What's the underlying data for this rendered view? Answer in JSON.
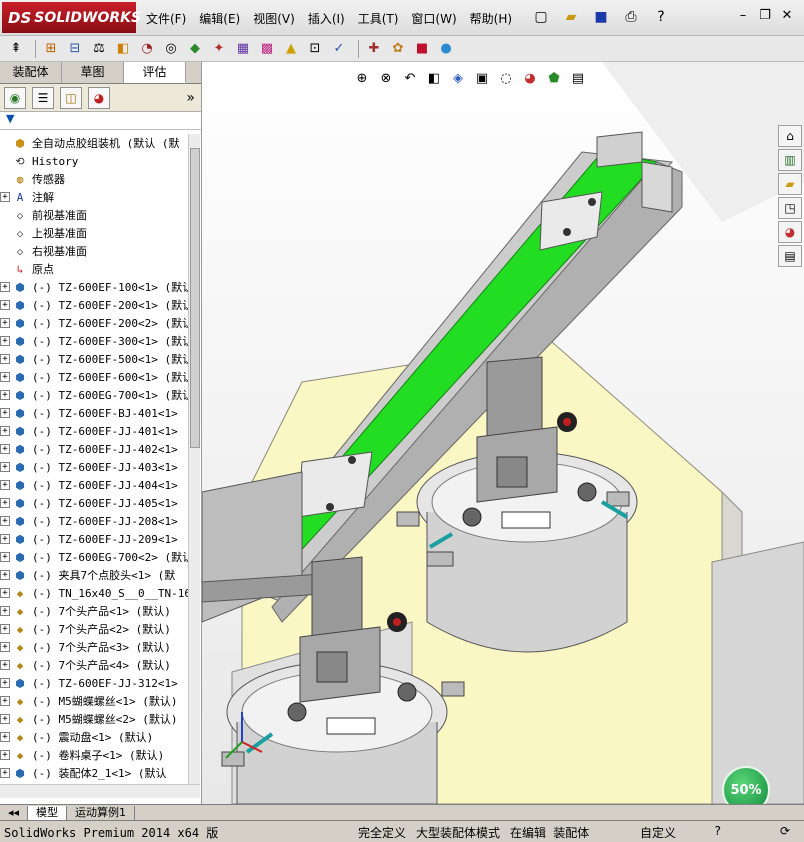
{
  "app": {
    "title": "SOLIDWORKS",
    "logo_prefix": "DS"
  },
  "menu": [
    "文件(F)",
    "编辑(E)",
    "视图(V)",
    "插入(I)",
    "工具(T)",
    "窗口(W)",
    "帮助(H)"
  ],
  "tabs": [
    "装配体",
    "草图",
    "评估"
  ],
  "tree": {
    "root": "全自动点胶组装机 (默认 (默",
    "items": [
      {
        "label": "History",
        "icon": "history-icon",
        "expand": false
      },
      {
        "label": "传感器",
        "icon": "sensor-icon",
        "expand": false
      },
      {
        "label": "注解",
        "icon": "annotation-icon",
        "expand": true
      },
      {
        "label": "前视基准面",
        "icon": "plane-icon",
        "expand": false
      },
      {
        "label": "上视基准面",
        "icon": "plane-icon",
        "expand": false
      },
      {
        "label": "右视基准面",
        "icon": "plane-icon",
        "expand": false
      },
      {
        "label": "原点",
        "icon": "origin-icon",
        "expand": false
      },
      {
        "label": "(-) TZ-600EF-100<1> (默认",
        "icon": "assembly-icon",
        "expand": true
      },
      {
        "label": "(-) TZ-600EF-200<1> (默认",
        "icon": "assembly-icon",
        "expand": true
      },
      {
        "label": "(-) TZ-600EF-200<2> (默认",
        "icon": "assembly-icon",
        "expand": true
      },
      {
        "label": "(-) TZ-600EF-300<1> (默认",
        "icon": "assembly-icon",
        "expand": true
      },
      {
        "label": "(-) TZ-600EF-500<1> (默认",
        "icon": "assembly-icon",
        "expand": true
      },
      {
        "label": "(-) TZ-600EF-600<1> (默认",
        "icon": "assembly-icon",
        "expand": true
      },
      {
        "label": "(-) TZ-600EG-700<1> (默认",
        "icon": "assembly-icon",
        "expand": true
      },
      {
        "label": "(-) TZ-600EF-BJ-401<1>",
        "icon": "assembly-icon",
        "expand": true
      },
      {
        "label": "(-) TZ-600EF-JJ-401<1>",
        "icon": "assembly-icon",
        "expand": true
      },
      {
        "label": "(-) TZ-600EF-JJ-402<1>",
        "icon": "assembly-icon",
        "expand": true
      },
      {
        "label": "(-) TZ-600EF-JJ-403<1>",
        "icon": "assembly-icon",
        "expand": true
      },
      {
        "label": "(-) TZ-600EF-JJ-404<1>",
        "icon": "assembly-icon",
        "expand": true
      },
      {
        "label": "(-) TZ-600EF-JJ-405<1>",
        "icon": "assembly-icon",
        "expand": true
      },
      {
        "label": "(-) TZ-600EF-JJ-208<1>",
        "icon": "assembly-icon",
        "expand": true
      },
      {
        "label": "(-) TZ-600EF-JJ-209<1>",
        "icon": "assembly-icon",
        "expand": true
      },
      {
        "label": "(-) TZ-600EG-700<2> (默认",
        "icon": "assembly-icon",
        "expand": true
      },
      {
        "label": "(-) 夹具7个点胶头<1> (默",
        "icon": "assembly-icon",
        "expand": true
      },
      {
        "label": "(-) TN_16x40_S__0__TN-16",
        "icon": "part-icon",
        "expand": true
      },
      {
        "label": "(-) 7个头产品<1> (默认)",
        "icon": "part-icon",
        "expand": true
      },
      {
        "label": "(-) 7个头产品<2> (默认)",
        "icon": "part-icon",
        "expand": true
      },
      {
        "label": "(-) 7个头产品<3> (默认)",
        "icon": "part-icon",
        "expand": true
      },
      {
        "label": "(-) 7个头产品<4> (默认)",
        "icon": "part-icon",
        "expand": true
      },
      {
        "label": "(-) TZ-600EF-JJ-312<1>",
        "icon": "assembly-icon",
        "expand": true
      },
      {
        "label": "(-) M5蝴蝶螺丝<1> (默认)",
        "icon": "part-icon",
        "expand": true
      },
      {
        "label": "(-) M5蝴蝶螺丝<2> (默认)",
        "icon": "part-icon",
        "expand": true
      },
      {
        "label": "(-) 震动盘<1> (默认)",
        "icon": "part-icon",
        "expand": true
      },
      {
        "label": "(-) 卷料桌子<1> (默认)",
        "icon": "part-icon",
        "expand": true
      },
      {
        "label": "(-) 装配体2_1<1> (默认",
        "icon": "assembly-icon",
        "expand": true
      }
    ]
  },
  "bottom_tabs": [
    "模型",
    "运动算例1"
  ],
  "status": {
    "product": "SolidWorks Premium 2014 x64 版",
    "defined": "完全定义",
    "mode": "大型装配体模式",
    "editing": "在编辑 装配体",
    "custom": "自定义"
  },
  "zoom": "50%",
  "colors": {
    "conveyor_belt": "#22dd22",
    "base_plate": "#fbf7c4",
    "brand": "#b01818"
  }
}
